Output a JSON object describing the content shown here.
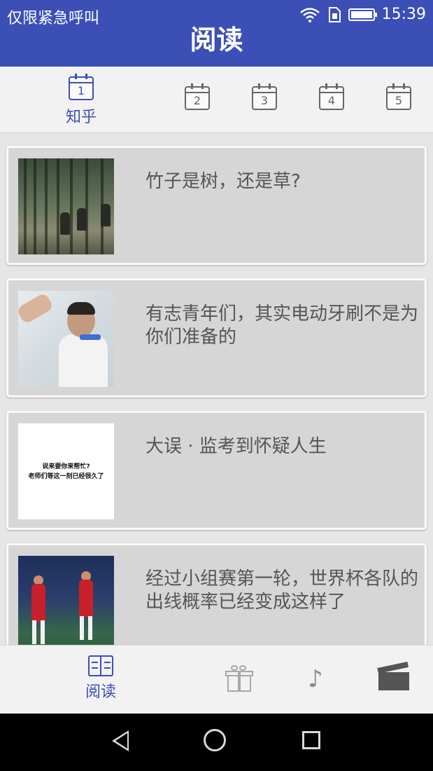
{
  "status_bar": {
    "carrier_text": "仅限紧急呼叫",
    "time": "15:39",
    "icons": [
      "wifi-icon",
      "sim-icon",
      "battery-icon"
    ]
  },
  "app_bar": {
    "title": "阅读"
  },
  "date_tabs": [
    {
      "number": "1",
      "label": "知乎",
      "active": true
    },
    {
      "number": "2",
      "label": "",
      "active": false
    },
    {
      "number": "3",
      "label": "",
      "active": false
    },
    {
      "number": "4",
      "label": "",
      "active": false
    },
    {
      "number": "5",
      "label": "",
      "active": false
    }
  ],
  "articles": [
    {
      "title": "竹子是树，还是草?",
      "thumbnail": "bamboo-forest-soldiers"
    },
    {
      "title": "有志青年们，其实电动牙刷不是为你们准备的",
      "thumbnail": "man-brushing-teeth"
    },
    {
      "title": "大误 · 监考到怀疑人生",
      "thumbnail": "text-meme",
      "thumbnail_text": [
        "说来要你来帮忙?",
        "老师们等这一刻已经很久了"
      ]
    },
    {
      "title": "经过小组赛第一轮，世界杯各队的出线概率已经变成这样了",
      "thumbnail": "soccer-players-celebrating"
    }
  ],
  "bottom_nav": {
    "items": [
      {
        "label": "阅读",
        "icon": "book-icon",
        "active": true
      },
      {
        "label": "",
        "icon": "gift-icon",
        "active": false
      },
      {
        "label": "",
        "icon": "music-note-icon",
        "active": false
      },
      {
        "label": "",
        "icon": "clapperboard-icon",
        "active": false
      }
    ]
  },
  "colors": {
    "primary": "#3c4fb6",
    "card_background": "#d6d6d6",
    "tab_bar_background": "#f2f2f2",
    "title_text": "#555555"
  }
}
